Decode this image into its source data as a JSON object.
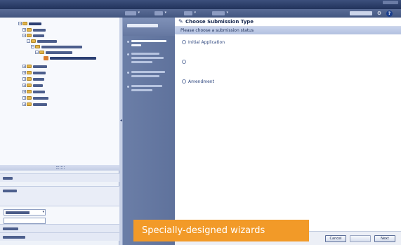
{
  "app": {
    "brand": "",
    "page_title": ""
  },
  "menubar": {
    "menus": [
      "",
      "",
      "",
      ""
    ]
  },
  "left_panel": {
    "nav": [
      "",
      "",
      ""
    ],
    "search": {
      "dropdown_value": ""
    }
  },
  "wizard": {
    "header": "",
    "steps": [
      "",
      "",
      "",
      ""
    ]
  },
  "content": {
    "title": "Choose Submission Type",
    "subtitle": "Please choose a submission status",
    "options": [
      {
        "label": "Initial Application",
        "description": ""
      },
      {
        "label": "",
        "description": ""
      },
      {
        "label": "Amendment",
        "description": ""
      }
    ]
  },
  "footer": {
    "cancel": "Cancel",
    "back": "",
    "next": "Next"
  },
  "caption": "Specially-designed wizards",
  "colors": {
    "header": "#2b3c66",
    "wizard_panel": "#6678a1",
    "caption_bg": "#f29a28"
  },
  "icons": {
    "title": "pencil-icon",
    "help": "help-icon",
    "settings": "gear-icon"
  }
}
